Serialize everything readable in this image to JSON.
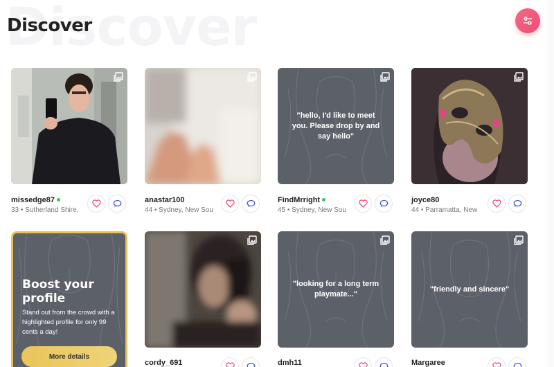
{
  "page": {
    "background_title": "Discover",
    "title": "Discover"
  },
  "colors": {
    "accent_pink": "#f24b72",
    "online_green": "#35c46b",
    "gold": "#e6c25a",
    "card_gray": "#5c6069"
  },
  "profiles": [
    {
      "name": "missedge87",
      "online": true,
      "meta": "33 • Sutherland Shire,",
      "kind": "photo",
      "icon": "photo-gallery-icon"
    },
    {
      "name": "anastar100",
      "online": false,
      "meta": "44 • Sydney, New Sou",
      "kind": "photo",
      "icon": "photo-gallery-icon"
    },
    {
      "name": "FindMrright",
      "online": true,
      "meta": "45 • Sydney, New Sou",
      "kind": "quote",
      "quote": "\"hello, I'd like to meet you. Please drop by and say hello\"",
      "icon": "photo-gallery-icon"
    },
    {
      "name": "joyce80",
      "online": false,
      "meta": "44 • Parramatta, New",
      "kind": "photo",
      "icon": "photo-gallery-icon"
    },
    {
      "name": "cordy_691",
      "online": false,
      "meta": "",
      "kind": "photo",
      "icon": "photo-gallery-icon"
    },
    {
      "name": "dmh11",
      "online": false,
      "meta": "",
      "kind": "quote",
      "quote": "\"looking for a long term playmate...\"",
      "icon": "photo-gallery-icon"
    },
    {
      "name": "Margaree",
      "online": false,
      "meta": "",
      "kind": "quote",
      "quote": "\"friendly and sincere\"",
      "icon": "photo-gallery-icon"
    }
  ],
  "boost": {
    "title": "Boost your profile",
    "description": "Stand out from the crowd with a highlighted profile for only 99 cents a day!",
    "button_label": "More details"
  },
  "icons": {
    "filter": "sliders-icon",
    "like": "heart-icon",
    "message": "chat-bubble-icon"
  }
}
